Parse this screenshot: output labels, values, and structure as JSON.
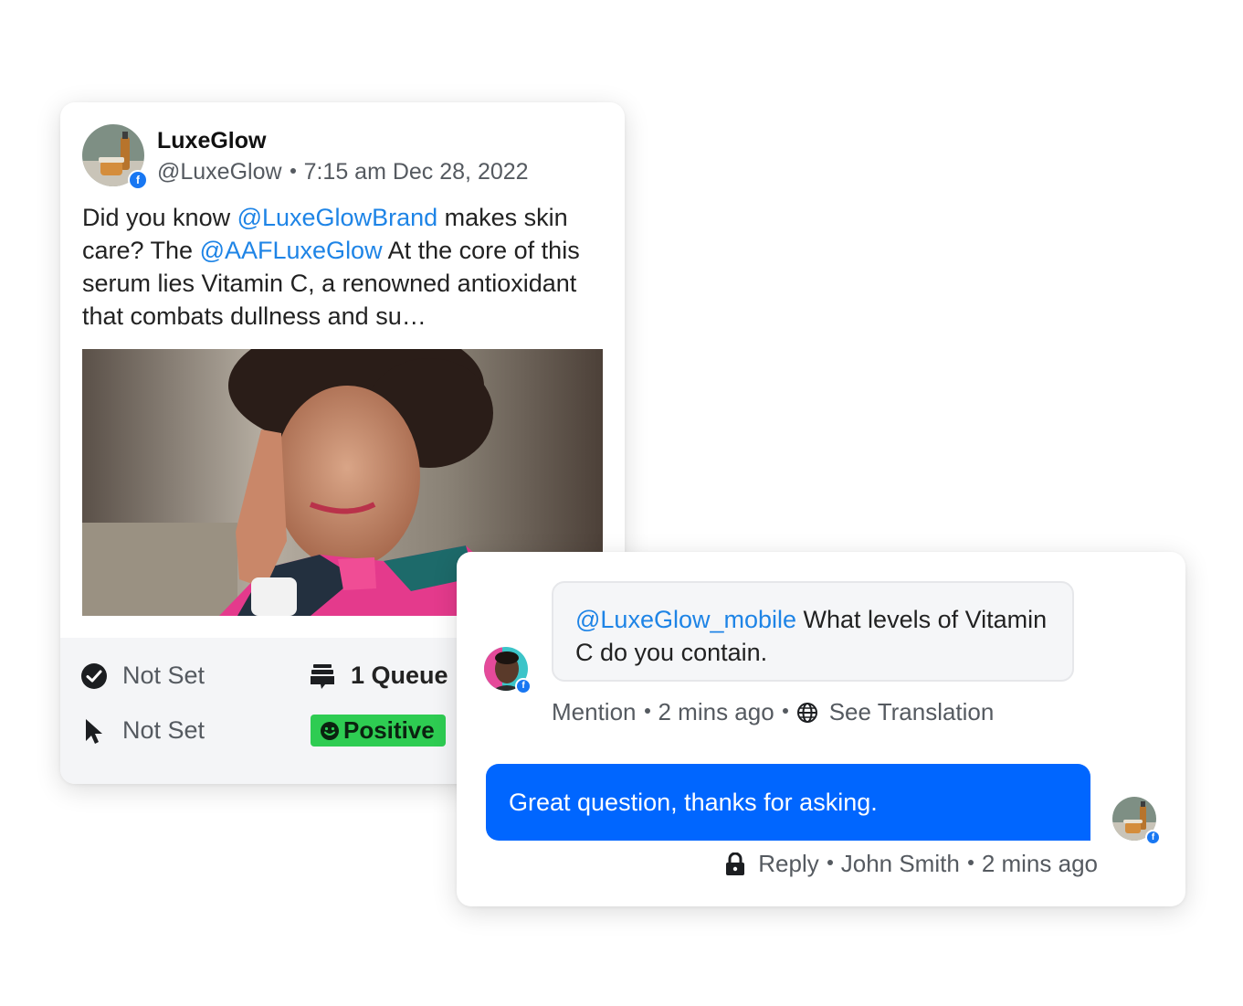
{
  "post": {
    "author_name": "LuxeGlow",
    "handle": "@LuxeGlow",
    "timestamp": "7:15 am Dec 28, 2022",
    "text_parts": {
      "p1": "Did you know ",
      "m1": "@LuxeGlowBrand",
      "p2": " makes skin care? The ",
      "m2": "@AAFLuxeGlow",
      "p3": " At the core of this serum lies Vitamin C, a renowned antioxidant that combats dullness and su…"
    },
    "platform_badge": "f",
    "footer": {
      "status_label": "Not Set",
      "assignee_label": "Not Set",
      "queue_label": "1 Queue",
      "sentiment_label": "Positive"
    }
  },
  "comment": {
    "mention": "@LuxeGlow_mobile",
    "text": " What levels of Vitamin C do you contain.",
    "type": "Mention",
    "time": "2 mins ago",
    "translation_link": "See Translation",
    "platform_badge": "f"
  },
  "reply": {
    "text": "Great question, thanks for asking.",
    "label": "Reply",
    "author": "John Smith",
    "time": "2 mins ago",
    "platform_badge": "f"
  },
  "icons": {
    "status": "check-circle-icon",
    "assignee": "cursor-icon",
    "queue": "queue-stack-icon",
    "sentiment": "smiley-icon",
    "translation": "globe-icon",
    "reply": "lock-icon"
  },
  "colors": {
    "mention": "#1e84e6",
    "reply_bubble": "#0066ff",
    "sentiment_positive": "#2ecc52",
    "facebook": "#1877f2"
  }
}
